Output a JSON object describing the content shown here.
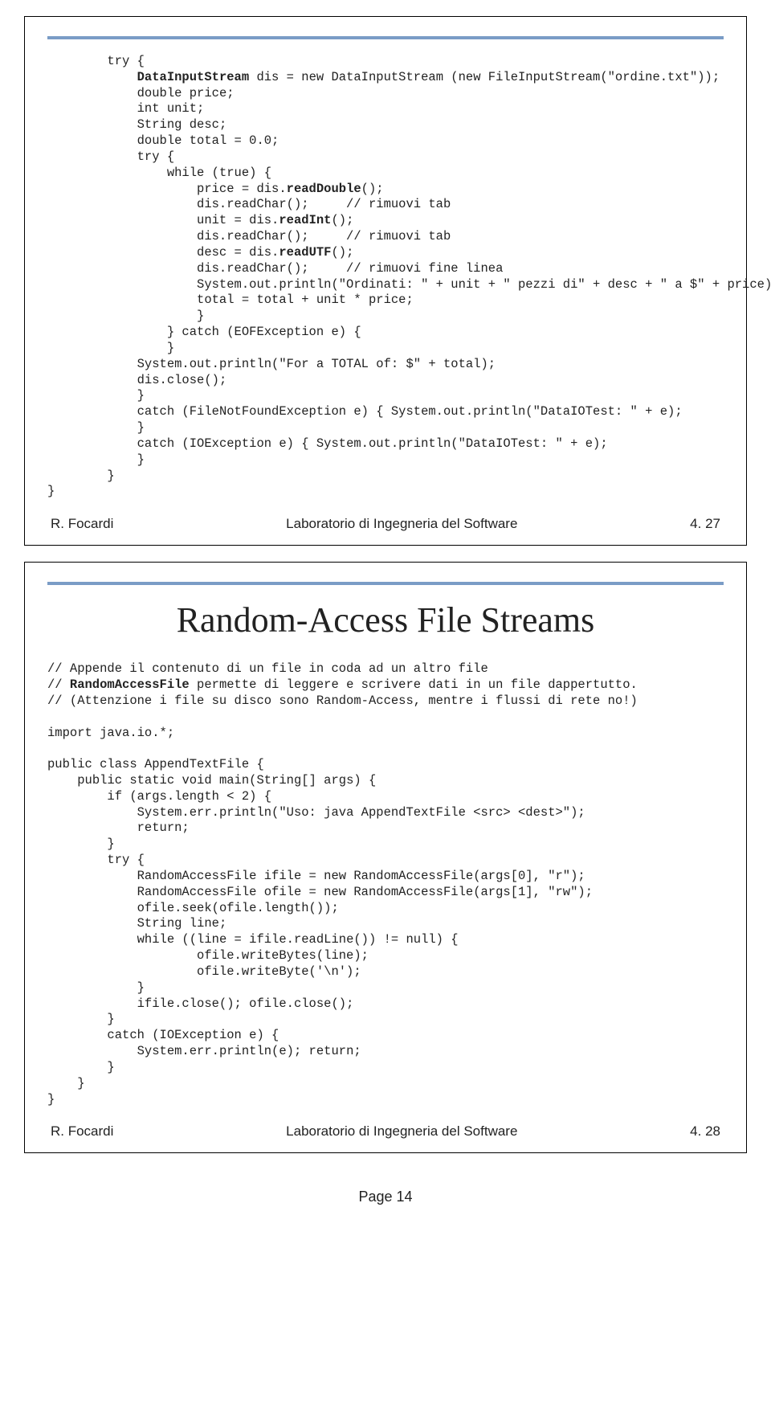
{
  "slide1": {
    "code_lines": [
      {
        "indent": 2,
        "parts": [
          {
            "t": "try {"
          }
        ]
      },
      {
        "indent": 3,
        "parts": [
          {
            "t": "DataInputStream",
            "b": true
          },
          {
            "t": " dis = new DataInputStream (new FileInputStream(\"ordine.txt\"));"
          }
        ]
      },
      {
        "indent": 3,
        "parts": [
          {
            "t": "double price;"
          }
        ]
      },
      {
        "indent": 3,
        "parts": [
          {
            "t": "int unit;"
          }
        ]
      },
      {
        "indent": 3,
        "parts": [
          {
            "t": "String desc;"
          }
        ]
      },
      {
        "indent": 3,
        "parts": [
          {
            "t": "double total = 0.0;"
          }
        ]
      },
      {
        "indent": 3,
        "parts": [
          {
            "t": "try {"
          }
        ]
      },
      {
        "indent": 4,
        "parts": [
          {
            "t": "while (true) {"
          }
        ]
      },
      {
        "indent": 5,
        "parts": [
          {
            "t": "price = dis."
          },
          {
            "t": "readDouble",
            "b": true
          },
          {
            "t": "();"
          }
        ]
      },
      {
        "indent": 5,
        "parts": [
          {
            "t": "dis.readChar();     // rimuovi tab"
          }
        ]
      },
      {
        "indent": 5,
        "parts": [
          {
            "t": "unit = dis."
          },
          {
            "t": "readInt",
            "b": true
          },
          {
            "t": "();"
          }
        ]
      },
      {
        "indent": 5,
        "parts": [
          {
            "t": "dis.readChar();     // rimuovi tab"
          }
        ]
      },
      {
        "indent": 5,
        "parts": [
          {
            "t": "desc = dis."
          },
          {
            "t": "readUTF",
            "b": true
          },
          {
            "t": "();"
          }
        ]
      },
      {
        "indent": 5,
        "parts": [
          {
            "t": "dis.readChar();     // rimuovi fine linea"
          }
        ]
      },
      {
        "indent": 5,
        "parts": [
          {
            "t": "System.out.println(\"Ordinati: \" + unit + \" pezzi di\" + desc + \" a $\" + price);"
          }
        ]
      },
      {
        "indent": 5,
        "parts": [
          {
            "t": "total = total + unit * price;"
          }
        ]
      },
      {
        "indent": 5,
        "parts": [
          {
            "t": "}"
          }
        ]
      },
      {
        "indent": 4,
        "parts": [
          {
            "t": "} catch (EOFException e) {"
          }
        ]
      },
      {
        "indent": 4,
        "parts": [
          {
            "t": "}"
          }
        ]
      },
      {
        "indent": 3,
        "parts": [
          {
            "t": "System.out.println(\"For a TOTAL of: $\" + total);"
          }
        ]
      },
      {
        "indent": 3,
        "parts": [
          {
            "t": "dis.close();"
          }
        ]
      },
      {
        "indent": 3,
        "parts": [
          {
            "t": "}"
          }
        ]
      },
      {
        "indent": 3,
        "parts": [
          {
            "t": "catch (FileNotFoundException e) { System.out.println(\"DataIOTest: \" + e);"
          }
        ]
      },
      {
        "indent": 3,
        "parts": [
          {
            "t": "}"
          }
        ]
      },
      {
        "indent": 3,
        "parts": [
          {
            "t": "catch (IOException e) { System.out.println(\"DataIOTest: \" + e);"
          }
        ]
      },
      {
        "indent": 3,
        "parts": [
          {
            "t": "}"
          }
        ]
      },
      {
        "indent": 2,
        "parts": [
          {
            "t": "}"
          }
        ]
      },
      {
        "indent": 0,
        "parts": [
          {
            "t": "}"
          }
        ]
      }
    ],
    "footer_left": "R. Focardi",
    "footer_center": "Laboratorio di Ingegneria del Software",
    "footer_right": "4. 27"
  },
  "slide2": {
    "title": "Random-Access File Streams",
    "code_lines": [
      {
        "indent": 0,
        "parts": [
          {
            "t": "// Appende il contenuto di un file in coda ad un altro file"
          }
        ]
      },
      {
        "indent": 0,
        "parts": [
          {
            "t": "// "
          },
          {
            "t": "RandomAccessFile",
            "b": true
          },
          {
            "t": " permette di leggere e scrivere dati in un file dappertutto."
          }
        ]
      },
      {
        "indent": 0,
        "parts": [
          {
            "t": "// (Attenzione i file su disco sono Random-Access, mentre i flussi di rete no!)"
          }
        ]
      },
      {
        "indent": 0,
        "parts": [
          {
            "t": ""
          }
        ]
      },
      {
        "indent": 0,
        "parts": [
          {
            "t": "import java.io.*;"
          }
        ]
      },
      {
        "indent": 0,
        "parts": [
          {
            "t": ""
          }
        ]
      },
      {
        "indent": 0,
        "parts": [
          {
            "t": "public class AppendTextFile {"
          }
        ]
      },
      {
        "indent": 1,
        "parts": [
          {
            "t": "public static void main(String[] args) {"
          }
        ]
      },
      {
        "indent": 2,
        "parts": [
          {
            "t": "if (args.length < 2) {"
          }
        ]
      },
      {
        "indent": 3,
        "parts": [
          {
            "t": "System.err.println(\"Uso: java AppendTextFile <src> <dest>\");"
          }
        ]
      },
      {
        "indent": 3,
        "parts": [
          {
            "t": "return;"
          }
        ]
      },
      {
        "indent": 2,
        "parts": [
          {
            "t": "}"
          }
        ]
      },
      {
        "indent": 2,
        "parts": [
          {
            "t": "try {"
          }
        ]
      },
      {
        "indent": 3,
        "parts": [
          {
            "t": "RandomAccessFile ifile = new RandomAccessFile(args[0], \"r\");"
          }
        ]
      },
      {
        "indent": 3,
        "parts": [
          {
            "t": "RandomAccessFile ofile = new RandomAccessFile(args[1], \"rw\");"
          }
        ]
      },
      {
        "indent": 3,
        "parts": [
          {
            "t": "ofile.seek(ofile.length());"
          }
        ]
      },
      {
        "indent": 3,
        "parts": [
          {
            "t": "String line;"
          }
        ]
      },
      {
        "indent": 3,
        "parts": [
          {
            "t": "while ((line = ifile.readLine()) != null) {"
          }
        ]
      },
      {
        "indent": 5,
        "parts": [
          {
            "t": "ofile.writeBytes(line);"
          }
        ]
      },
      {
        "indent": 5,
        "parts": [
          {
            "t": "ofile.writeByte('\\n');"
          }
        ]
      },
      {
        "indent": 3,
        "parts": [
          {
            "t": "}"
          }
        ]
      },
      {
        "indent": 3,
        "parts": [
          {
            "t": "ifile.close(); ofile.close();"
          }
        ]
      },
      {
        "indent": 2,
        "parts": [
          {
            "t": "}"
          }
        ]
      },
      {
        "indent": 2,
        "parts": [
          {
            "t": "catch (IOException e) {"
          }
        ]
      },
      {
        "indent": 3,
        "parts": [
          {
            "t": "System.err.println(e); return;"
          }
        ]
      },
      {
        "indent": 2,
        "parts": [
          {
            "t": "}"
          }
        ]
      },
      {
        "indent": 1,
        "parts": [
          {
            "t": "}"
          }
        ]
      },
      {
        "indent": 0,
        "parts": [
          {
            "t": "}"
          }
        ]
      }
    ],
    "footer_left": "R. Focardi",
    "footer_center": "Laboratorio di Ingegneria del Software",
    "footer_right": "4. 28"
  },
  "page_label": "Page 14"
}
